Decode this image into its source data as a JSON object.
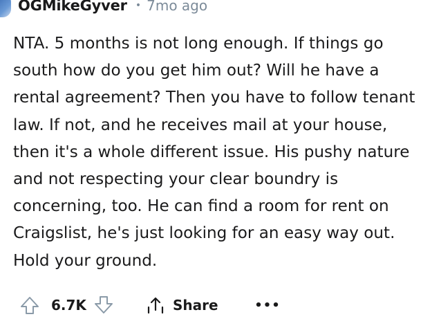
{
  "comment": {
    "username": "OGMikeGyver",
    "separator": "•",
    "time": "7mo ago",
    "lines": [
      "NTA. 5 months is not long enough. If things go",
      "south how do you get him out? Will he have a",
      "rental agreement? Then you have to follow tenant",
      "law. If not, and he receives mail at your house,",
      "then it's a whole different issue. His pushy nature",
      "and not respecting your clear boundry is",
      "concerning, too. He can find a room for rent on",
      "Craigslist, he's just looking for an easy way out.",
      "Hold your ground."
    ]
  },
  "actions": {
    "score": "6.7K",
    "share_label": "Share",
    "more_label": "•••",
    "icons": {
      "upvote": "arrow-up-icon",
      "downvote": "arrow-down-icon",
      "share": "share-icon",
      "more": "more-options-icon"
    }
  },
  "colors": {
    "text": "#1a1a1b",
    "meta": "#7c8b99",
    "icon": "#8a9aa8"
  }
}
